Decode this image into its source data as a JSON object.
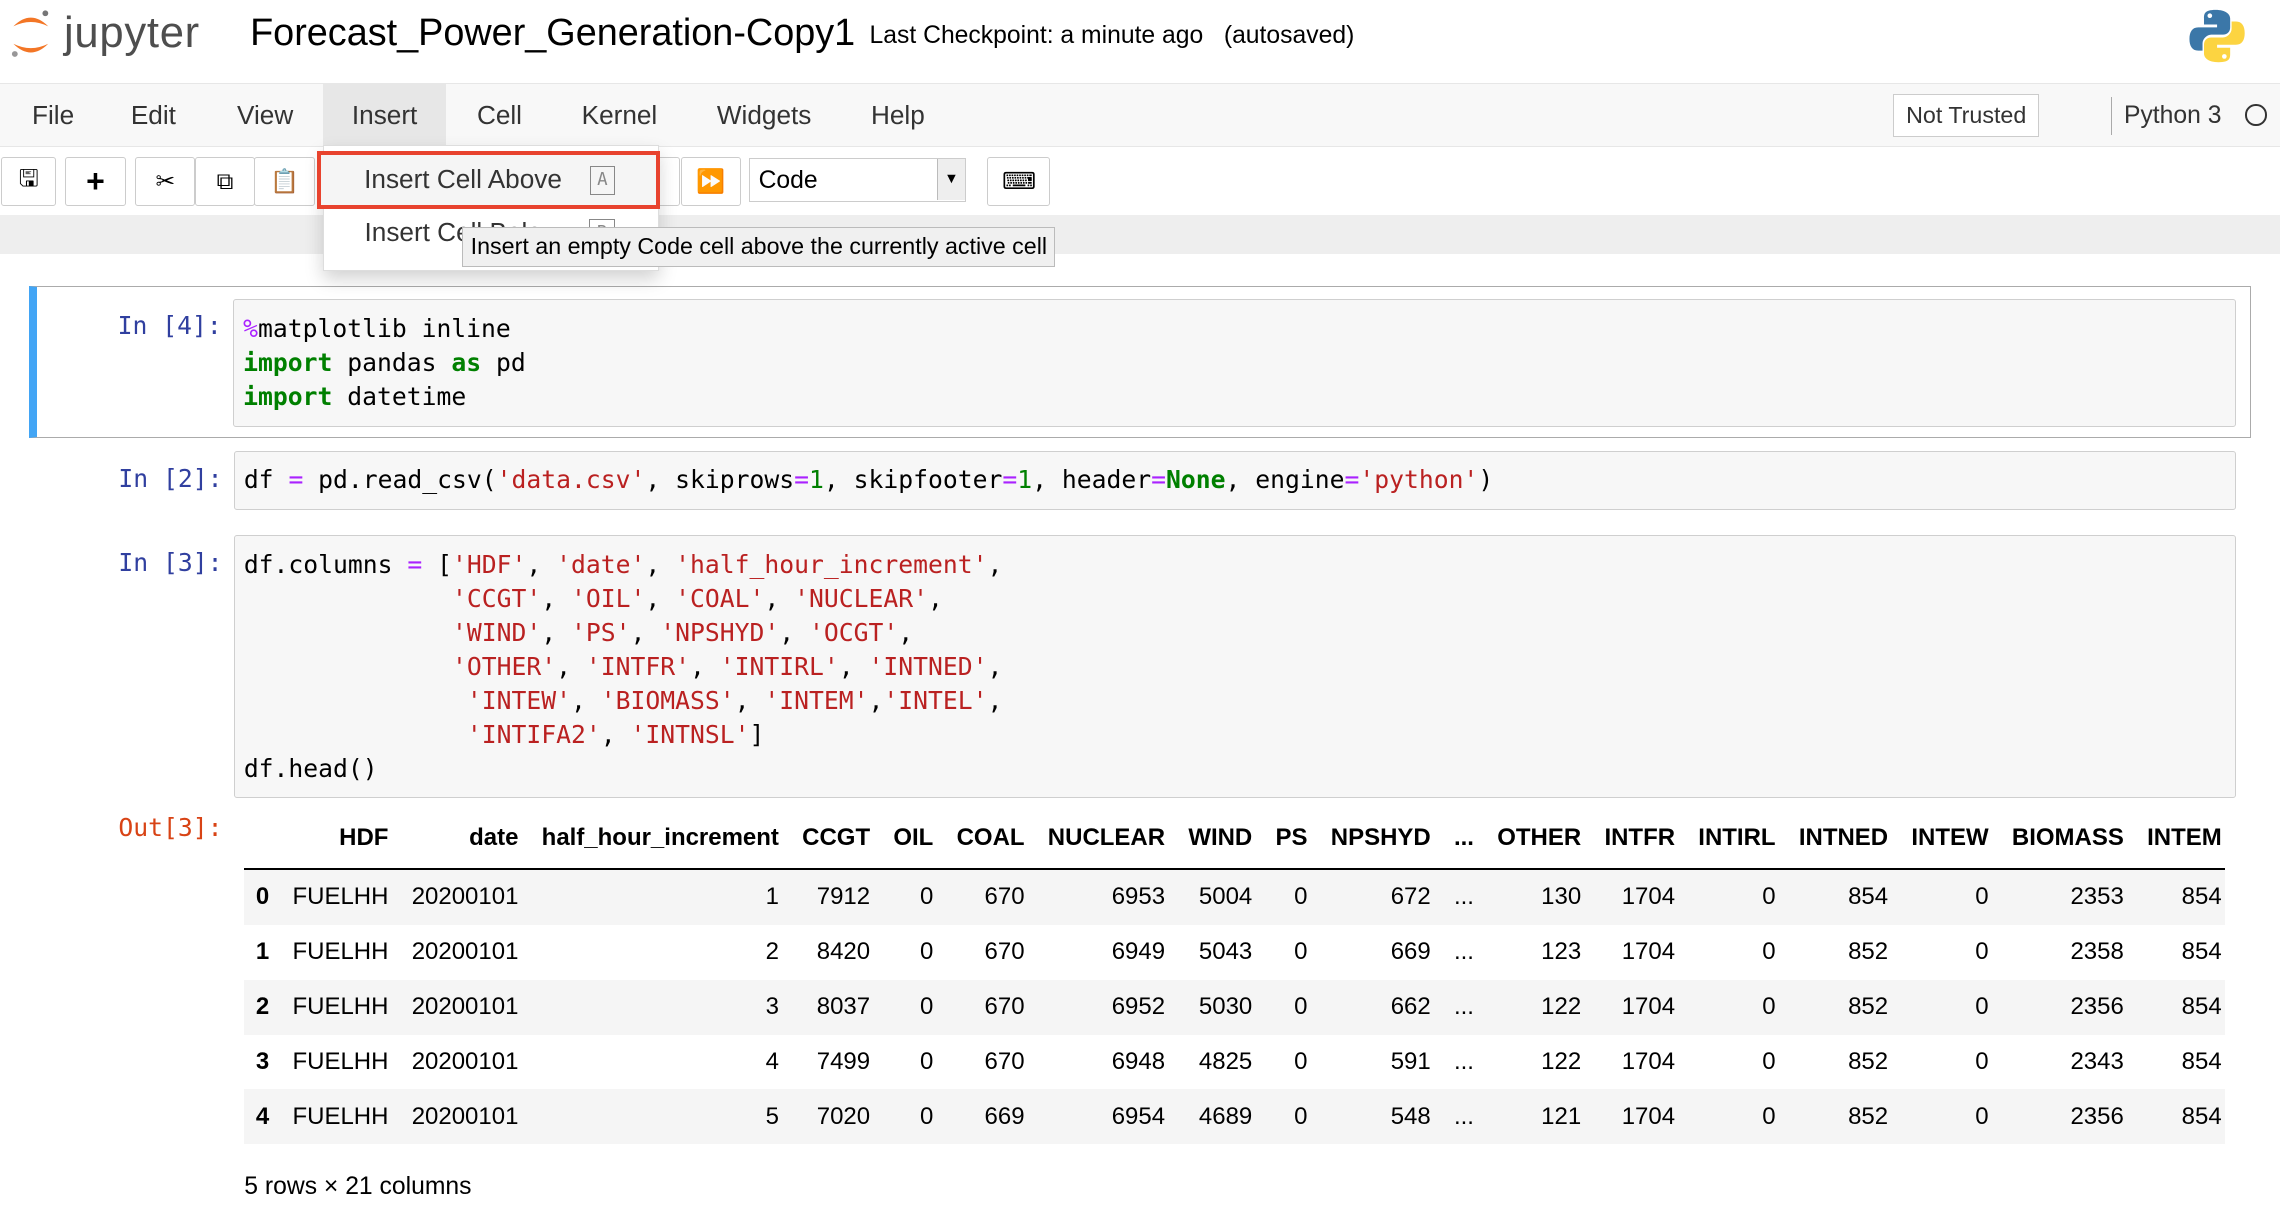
{
  "header": {
    "logo_text": "jupyter",
    "title": "Forecast_Power_Generation-Copy1",
    "checkpoint": "Last Checkpoint: a minute ago",
    "autosaved": "(autosaved)"
  },
  "menubar": {
    "items": [
      "File",
      "Edit",
      "View",
      "Insert",
      "Cell",
      "Kernel",
      "Widgets",
      "Help"
    ],
    "active": "Insert",
    "trusted": "Not Trusted",
    "kernel": "Python 3"
  },
  "toolbar": {
    "cell_type": "Code",
    "icons": [
      "save-icon",
      "plus-icon",
      "cut-icon",
      "copy-icon",
      "paste-icon",
      "fast-forward-icon",
      "keyboard-icon"
    ]
  },
  "insert_menu": {
    "items": [
      {
        "label": "Insert Cell Above",
        "shortcut": "A"
      },
      {
        "label": "Insert Cell Below",
        "shortcut": "B"
      }
    ],
    "tooltip": "Insert an empty Code cell above the currently active cell"
  },
  "cells": [
    {
      "prompt": "In [4]:",
      "lines": [
        [
          [
            "mg",
            "%"
          ],
          [
            "",
            "matplotlib inline"
          ]
        ],
        [
          [
            "kw",
            "import"
          ],
          [
            "",
            " pandas "
          ],
          [
            "kw",
            "as"
          ],
          [
            "",
            " pd"
          ]
        ],
        [
          [
            "kw",
            "import"
          ],
          [
            "",
            " datetime"
          ]
        ]
      ]
    },
    {
      "prompt": "In [2]:",
      "lines": [
        [
          [
            "",
            "df "
          ],
          [
            "op",
            "="
          ],
          [
            "",
            " pd.read_csv("
          ],
          [
            "str",
            "'data.csv'"
          ],
          [
            "",
            ", skiprows"
          ],
          [
            "op",
            "="
          ],
          [
            "num",
            "1"
          ],
          [
            "",
            ", skipfooter"
          ],
          [
            "op",
            "="
          ],
          [
            "num",
            "1"
          ],
          [
            "",
            ", header"
          ],
          [
            "op",
            "="
          ],
          [
            "kw",
            "None"
          ],
          [
            "",
            ", engine"
          ],
          [
            "op",
            "="
          ],
          [
            "str",
            "'python'"
          ],
          [
            "",
            ")"
          ]
        ]
      ]
    },
    {
      "prompt": "In [3]:",
      "lines": [
        [
          [
            "",
            "df.columns "
          ],
          [
            "op",
            "="
          ],
          [
            "",
            " ["
          ],
          [
            "str",
            "'HDF'"
          ],
          [
            "",
            ", "
          ],
          [
            "str",
            "'date'"
          ],
          [
            "",
            ", "
          ],
          [
            "str",
            "'half_hour_increment'"
          ],
          [
            "",
            ","
          ]
        ],
        [
          [
            "",
            "              "
          ],
          [
            "str",
            "'CCGT'"
          ],
          [
            "",
            ", "
          ],
          [
            "str",
            "'OIL'"
          ],
          [
            "",
            ", "
          ],
          [
            "str",
            "'COAL'"
          ],
          [
            "",
            ", "
          ],
          [
            "str",
            "'NUCLEAR'"
          ],
          [
            "",
            ","
          ]
        ],
        [
          [
            "",
            "              "
          ],
          [
            "str",
            "'WIND'"
          ],
          [
            "",
            ", "
          ],
          [
            "str",
            "'PS'"
          ],
          [
            "",
            ", "
          ],
          [
            "str",
            "'NPSHYD'"
          ],
          [
            "",
            ", "
          ],
          [
            "str",
            "'OCGT'"
          ],
          [
            "",
            ","
          ]
        ],
        [
          [
            "",
            "              "
          ],
          [
            "str",
            "'OTHER'"
          ],
          [
            "",
            ", "
          ],
          [
            "str",
            "'INTFR'"
          ],
          [
            "",
            ", "
          ],
          [
            "str",
            "'INTIRL'"
          ],
          [
            "",
            ", "
          ],
          [
            "str",
            "'INTNED'"
          ],
          [
            "",
            ","
          ]
        ],
        [
          [
            "",
            "               "
          ],
          [
            "str",
            "'INTEW'"
          ],
          [
            "",
            ", "
          ],
          [
            "str",
            "'BIOMASS'"
          ],
          [
            "",
            ", "
          ],
          [
            "str",
            "'INTEM'"
          ],
          [
            "",
            ","
          ],
          [
            "str",
            "'INTEL'"
          ],
          [
            "",
            ","
          ]
        ],
        [
          [
            "",
            "               "
          ],
          [
            "str",
            "'INTIFA2'"
          ],
          [
            "",
            ", "
          ],
          [
            "str",
            "'INTNSL'"
          ],
          [
            "",
            "]"
          ]
        ],
        [
          [
            "",
            "df.head()"
          ]
        ]
      ]
    }
  ],
  "output": {
    "prompt": "Out[3]:",
    "columns": [
      "",
      "HDF",
      "date",
      "half_hour_increment",
      "CCGT",
      "OIL",
      "COAL",
      "NUCLEAR",
      "WIND",
      "PS",
      "NPSHYD",
      "...",
      "OTHER",
      "INTFR",
      "INTIRL",
      "INTNED",
      "INTEW",
      "BIOMASS",
      "INTEM"
    ],
    "rows": [
      [
        "0",
        "FUELHH",
        "20200101",
        "1",
        "7912",
        "0",
        "670",
        "6953",
        "5004",
        "0",
        "672",
        "...",
        "130",
        "1704",
        "0",
        "854",
        "0",
        "2353",
        "854"
      ],
      [
        "1",
        "FUELHH",
        "20200101",
        "2",
        "8420",
        "0",
        "670",
        "6949",
        "5043",
        "0",
        "669",
        "...",
        "123",
        "1704",
        "0",
        "852",
        "0",
        "2358",
        "854"
      ],
      [
        "2",
        "FUELHH",
        "20200101",
        "3",
        "8037",
        "0",
        "670",
        "6952",
        "5030",
        "0",
        "662",
        "...",
        "122",
        "1704",
        "0",
        "852",
        "0",
        "2356",
        "854"
      ],
      [
        "3",
        "FUELHH",
        "20200101",
        "4",
        "7499",
        "0",
        "670",
        "6948",
        "4825",
        "0",
        "591",
        "...",
        "122",
        "1704",
        "0",
        "852",
        "0",
        "2343",
        "854"
      ],
      [
        "4",
        "FUELHH",
        "20200101",
        "5",
        "7020",
        "0",
        "669",
        "6954",
        "4689",
        "0",
        "548",
        "...",
        "121",
        "1704",
        "0",
        "852",
        "0",
        "2356",
        "854"
      ]
    ],
    "shape": "5 rows × 21 columns"
  },
  "colors": {
    "accent": "#42a5f5",
    "highlight_box": "#e8432e",
    "prompt_in": "#303f9f",
    "prompt_out": "#d84315"
  }
}
